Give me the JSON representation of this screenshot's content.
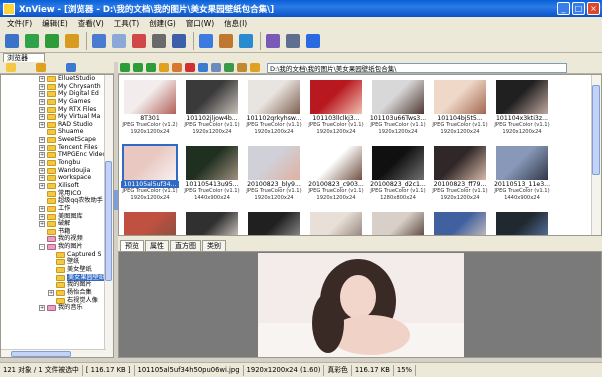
{
  "window": {
    "title": "XnView - [浏览器 - D:\\我的文档\\我的图片\\美女果园壁纸包合集\\]",
    "minimize": "_",
    "maximize": "□",
    "close": "×"
  },
  "menu": [
    "文件(F)",
    "编辑(E)",
    "查看(V)",
    "工具(T)",
    "创建(G)",
    "窗口(W)",
    "信息(I)"
  ],
  "toolbar_icons": [
    {
      "name": "browser-icon",
      "color": "#3b73c9"
    },
    {
      "name": "refresh-icon",
      "color": "#2fa24a"
    },
    {
      "name": "back-arrow-icon",
      "color": "#2f9c3a"
    },
    {
      "name": "forward-arrow-icon",
      "color": "#d89a1f"
    },
    {
      "name": "open-icon",
      "color": "#4a7bd0"
    },
    {
      "name": "copy-icon",
      "color": "#8aa8d8"
    },
    {
      "name": "capture-icon",
      "color": "#d04848"
    },
    {
      "name": "print-icon",
      "color": "#6a6a6a"
    },
    {
      "name": "scan-icon",
      "color": "#3b5fa8"
    },
    {
      "name": "slideshow-icon",
      "color": "#3b7be0"
    },
    {
      "name": "compare-icon",
      "color": "#c07830"
    },
    {
      "name": "web-icon",
      "color": "#2a8ad0"
    },
    {
      "name": "convert-icon",
      "color": "#7a5ab8"
    },
    {
      "name": "settings-icon",
      "color": "#5f6f8f"
    },
    {
      "name": "info-icon",
      "color": "#2a6ae0"
    }
  ],
  "tab_label": "浏览器",
  "tree": {
    "rows": [
      {
        "label": "ElluetStudio",
        "indent": 4,
        "expander": "+",
        "special": false
      },
      {
        "label": "My Chrysanth",
        "indent": 4,
        "expander": "+",
        "special": false
      },
      {
        "label": "My Digital Ed",
        "indent": 4,
        "expander": "+",
        "special": false
      },
      {
        "label": "My Games",
        "indent": 4,
        "expander": "+",
        "special": false
      },
      {
        "label": "My RTX Files",
        "indent": 4,
        "expander": "+",
        "special": false
      },
      {
        "label": "My Virtual Ma",
        "indent": 4,
        "expander": "+",
        "special": false
      },
      {
        "label": "RAD Studio",
        "indent": 4,
        "expander": "+",
        "special": false
      },
      {
        "label": "Shuame",
        "indent": 4,
        "expander": "",
        "special": false
      },
      {
        "label": "SweetScape",
        "indent": 4,
        "expander": "+",
        "special": false
      },
      {
        "label": "Tencent Files",
        "indent": 4,
        "expander": "+",
        "special": false
      },
      {
        "label": "TMPGEnc Video",
        "indent": 4,
        "expander": "+",
        "special": false
      },
      {
        "label": "Tongbu",
        "indent": 4,
        "expander": "+",
        "special": false
      },
      {
        "label": "Wandoujia",
        "indent": 4,
        "expander": "+",
        "special": false
      },
      {
        "label": "workspace",
        "indent": 4,
        "expander": "+",
        "special": false
      },
      {
        "label": "Xilisoft",
        "indent": 4,
        "expander": "+",
        "special": false
      },
      {
        "label": "常用ICO",
        "indent": 4,
        "expander": "",
        "special": false
      },
      {
        "label": "超级qq农牧助手",
        "indent": 4,
        "expander": "",
        "special": false
      },
      {
        "label": "工作",
        "indent": 4,
        "expander": "+",
        "special": false
      },
      {
        "label": "美图图库",
        "indent": 4,
        "expander": "+",
        "special": false
      },
      {
        "label": "破解",
        "indent": 4,
        "expander": "+",
        "special": false
      },
      {
        "label": "书籍",
        "indent": 4,
        "expander": "",
        "special": false
      },
      {
        "label": "我的视频",
        "indent": 4,
        "expander": "",
        "special": true
      },
      {
        "label": "我的图片",
        "indent": 4,
        "expander": "-",
        "special": true
      },
      {
        "label": "Captured S",
        "indent": 5,
        "expander": "",
        "special": false
      },
      {
        "label": "壁纸",
        "indent": 5,
        "expander": "",
        "special": false
      },
      {
        "label": "美女壁纸",
        "indent": 5,
        "expander": "",
        "special": false
      },
      {
        "label": "美女果园壁纸",
        "indent": 5,
        "expander": "",
        "special": false,
        "selected": true
      },
      {
        "label": "我的图片",
        "indent": 5,
        "expander": "",
        "special": false
      },
      {
        "label": "杨怡合集",
        "indent": 5,
        "expander": "+",
        "special": false
      },
      {
        "label": "右视觉人像",
        "indent": 5,
        "expander": "",
        "special": false
      },
      {
        "label": "我的音乐",
        "indent": 4,
        "expander": "+",
        "special": true
      }
    ]
  },
  "browser_toolbar_icons": [
    {
      "name": "nav-back-icon",
      "color": "#2f9c3a"
    },
    {
      "name": "nav-forward-icon",
      "color": "#2f9c3a"
    },
    {
      "name": "nav-up-icon",
      "color": "#2f9c3a"
    },
    {
      "name": "star-icon",
      "color": "#e0a020"
    },
    {
      "name": "copy-to-icon",
      "color": "#d87830"
    },
    {
      "name": "delete-icon",
      "color": "#d03030"
    },
    {
      "name": "rotate-icon",
      "color": "#3a7ad0"
    },
    {
      "name": "view-mode-icon",
      "color": "#6a8ac0"
    },
    {
      "name": "sort-icon",
      "color": "#3a9a4a"
    },
    {
      "name": "filter-icon",
      "color": "#c08a30"
    },
    {
      "name": "favorite-icon",
      "color": "#e0a020"
    }
  ],
  "path": "D:\\我的文档\\我的图片\\美女果园壁纸包合集\\",
  "thumbnails": [
    {
      "name": "8T301",
      "info": "JPEG TrueColor (v1.2)",
      "dims": "1920x1200x24",
      "colors": [
        "#f2ecec",
        "#b06058"
      ]
    },
    {
      "name": "101102jljow4b...",
      "info": "JPEG TrueColor (v1.1)",
      "dims": "1920x1200x24",
      "colors": [
        "#3a3a3a",
        "#c8c0b8"
      ]
    },
    {
      "name": "101102qrkyhsw...",
      "info": "JPEG TrueColor (v1.1)",
      "dims": "1920x1200x24",
      "colors": [
        "#e8e4e0",
        "#806050"
      ]
    },
    {
      "name": "101103llclkj3...",
      "info": "JPEG TrueColor (v1.1)",
      "dims": "1920x1200x24",
      "colors": [
        "#b81820",
        "#f0c0b0"
      ]
    },
    {
      "name": "101103u66Tws3...",
      "info": "JPEG TrueColor (v1.1)",
      "dims": "1920x1200x24",
      "colors": [
        "#d8d8d8",
        "#503830"
      ]
    },
    {
      "name": "101104bj5t5...",
      "info": "JPEG TrueColor (v1.1)",
      "dims": "1920x1200x24",
      "colors": [
        "#f0d8c8",
        "#a06850"
      ]
    },
    {
      "name": "101104x3kti3z...",
      "info": "JPEG TrueColor (v1.1)",
      "dims": "1920x1200x24",
      "colors": [
        "#202020",
        "#c0a8a0"
      ]
    },
    {
      "name": "101105al5uf34...",
      "info": "JPEG TrueColor (v1.1)",
      "dims": "1920x1200x24",
      "colors": [
        "#e8c8c0",
        "#f8f0f0"
      ],
      "selected": true
    },
    {
      "name": "101105413u95...",
      "info": "JPEG TrueColor (v1.1)",
      "dims": "1440x900x24",
      "colors": [
        "#203020",
        "#a09080"
      ]
    },
    {
      "name": "20100823_bly9...",
      "info": "JPEG TrueColor (v1.1)",
      "dims": "1920x1200x24",
      "colors": [
        "#d0d0d8",
        "#e0b0a0"
      ]
    },
    {
      "name": "20100823_c903...",
      "info": "JPEG TrueColor (v1.1)",
      "dims": "1920x1200x24",
      "colors": [
        "#ffffff",
        "#705040"
      ]
    },
    {
      "name": "20100823_d2c1...",
      "info": "JPEG TrueColor (v1.1)",
      "dims": "1280x800x24",
      "colors": [
        "#101010",
        "#707070"
      ]
    },
    {
      "name": "20100823_ff79...",
      "info": "JPEG TrueColor (v1.1)",
      "dims": "1920x1200x24",
      "colors": [
        "#302828",
        "#d8b8a8"
      ]
    },
    {
      "name": "20110513_11e3...",
      "info": "JPEG TrueColor (v1.1)",
      "dims": "1440x900x24",
      "colors": [
        "#8898b8",
        "#303848"
      ]
    },
    {
      "name": "",
      "info": "",
      "dims": "",
      "colors": [
        "#c05040",
        "#805040"
      ]
    },
    {
      "name": "",
      "info": "",
      "dims": "",
      "colors": [
        "#303030",
        "#f0e8e0"
      ]
    },
    {
      "name": "",
      "info": "",
      "dims": "",
      "colors": [
        "#202020",
        "#a0a0a0"
      ]
    },
    {
      "name": "",
      "info": "",
      "dims": "",
      "colors": [
        "#e8e0d8",
        "#807068"
      ]
    },
    {
      "name": "",
      "info": "",
      "dims": "",
      "colors": [
        "#d8d0c8",
        "#402820"
      ]
    },
    {
      "name": "",
      "info": "",
      "dims": "",
      "colors": [
        "#4060a0",
        "#e0d0c0"
      ]
    },
    {
      "name": "",
      "info": "",
      "dims": "",
      "colors": [
        "#202830",
        "#6080b0"
      ]
    }
  ],
  "preview_tabs": [
    "预览",
    "属性",
    "直方图",
    "类别"
  ],
  "statusbar": [
    "121 对象 / 1 文件被选中",
    "[ 116.17 KB ]",
    "101105al5uf34h50pu06wi.jpg",
    "1920x1200x24 (1.60)",
    "真彩色",
    "116.17 KB",
    "15%"
  ]
}
